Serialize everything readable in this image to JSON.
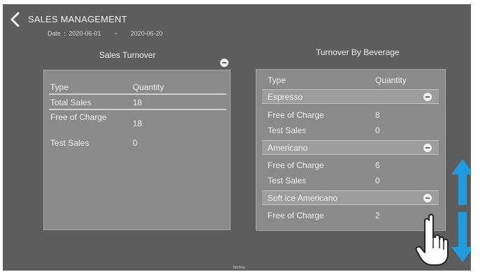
{
  "header": {
    "title": "SALES MANAGEMENT",
    "date_label": "Date : 2020-06-01",
    "date_sep": "~",
    "date_end": "2020-06-20"
  },
  "sales_turnover": {
    "title": "Sales Turnover",
    "col_type": "Type",
    "col_qty": "Quantity",
    "rows": [
      {
        "type": "Total Sales",
        "qty": "18"
      },
      {
        "type": "Free of Charge",
        "qty": "18"
      },
      {
        "type": "Test Sales",
        "qty": "0"
      }
    ]
  },
  "beverage_turnover": {
    "title": "Turnover By Beverage",
    "col_type": "Type",
    "col_qty": "Quantity",
    "groups": [
      {
        "name": "Espresso",
        "rows": [
          {
            "type": "Free of Charge",
            "qty": "8"
          },
          {
            "type": "Test Sales",
            "qty": "0"
          }
        ]
      },
      {
        "name": "Americano",
        "rows": [
          {
            "type": "Free of Charge",
            "qty": "6"
          },
          {
            "type": "Test Sales",
            "qty": "0"
          }
        ]
      },
      {
        "name": "Soft ice Americano",
        "rows": [
          {
            "type": "Free of Charge",
            "qty": "2"
          }
        ]
      }
    ]
  },
  "footer": {
    "text": "TabTina"
  },
  "icons": {
    "back": "chevron-left-icon",
    "collapse": "minus-circle-icon",
    "scroll_up": "arrow-up-icon",
    "scroll_down": "arrow-down-icon",
    "hand": "hand-pointer-icon"
  },
  "colors": {
    "background": "#5d5d5d",
    "panel": "#8a8a8a",
    "group_header": "#9d9d9d",
    "arrow": "#1f9be0"
  }
}
